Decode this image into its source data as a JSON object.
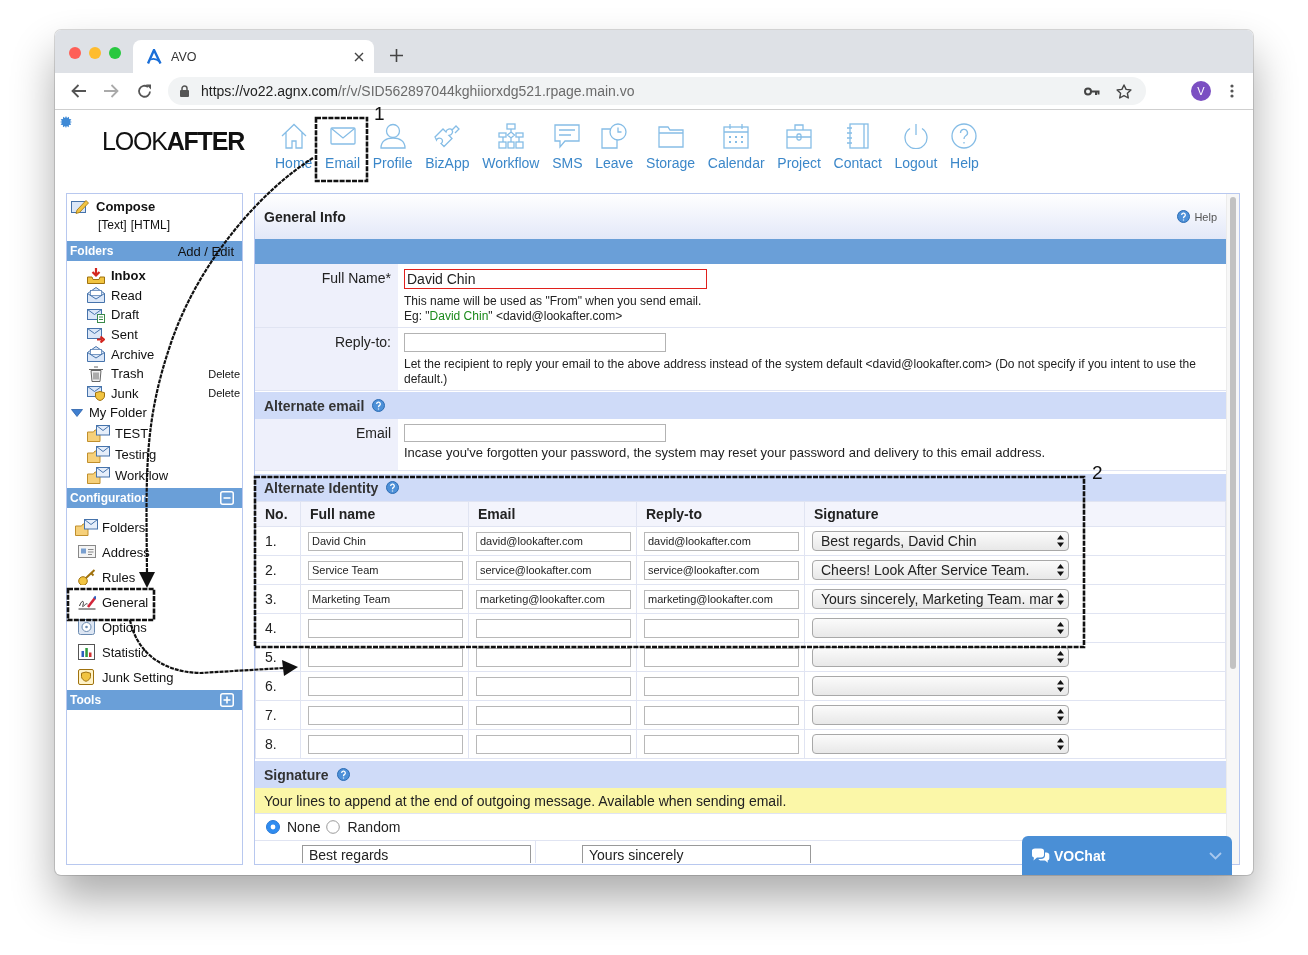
{
  "browser": {
    "tab_title": "AVO",
    "url": {
      "host": "https://vo22.agnx.com",
      "path": "/r/v/SID562897044kghiiorxdg521.rpage.main.vo"
    },
    "profile_initial": "V"
  },
  "logo": "LOOK**AFTER**",
  "nav": [
    {
      "label": "Home",
      "kind": "home"
    },
    {
      "label": "Email",
      "kind": "mail"
    },
    {
      "label": "Profile",
      "kind": "person"
    },
    {
      "label": "BizApp",
      "kind": "puzzle"
    },
    {
      "label": "Workflow",
      "kind": "flow"
    },
    {
      "label": "SMS",
      "kind": "chat"
    },
    {
      "label": "Leave",
      "kind": "clock"
    },
    {
      "label": "Storage",
      "kind": "folder"
    },
    {
      "label": "Calendar",
      "kind": "calendar"
    },
    {
      "label": "Project",
      "kind": "briefcase"
    },
    {
      "label": "Contact",
      "kind": "notebook"
    },
    {
      "label": "Logout",
      "kind": "power"
    },
    {
      "label": "Help",
      "kind": "help"
    }
  ],
  "sidebar": {
    "compose": {
      "label": "Compose",
      "formats": [
        "[Text]",
        "[HTML]"
      ]
    },
    "folders": {
      "title": "Folders",
      "action": "Add / Edit",
      "items": [
        {
          "label": "Inbox",
          "kind": "inbox",
          "unread": true
        },
        {
          "label": "Read",
          "kind": "read",
          "unread": false
        },
        {
          "label": "Draft",
          "kind": "draft",
          "unread": false
        },
        {
          "label": "Sent",
          "kind": "sent",
          "unread": false
        },
        {
          "label": "Archive",
          "kind": "archive",
          "unread": false
        },
        {
          "label": "Trash",
          "kind": "trash",
          "unread": false,
          "action": "Delete"
        },
        {
          "label": "Junk",
          "kind": "junk",
          "unread": false,
          "action": "Delete"
        },
        {
          "label": "My Folder",
          "kind": "group",
          "unread": false,
          "expanded": true,
          "children": [
            {
              "label": "TEST",
              "kind": "folder",
              "unread": false
            },
            {
              "label": "Testing",
              "kind": "folder",
              "unread": false
            },
            {
              "label": "Workflow",
              "kind": "folder",
              "unread": false
            }
          ]
        }
      ]
    },
    "configuration": {
      "title": "Configuration",
      "expanded": true,
      "items": [
        {
          "label": "Folders",
          "kind": "folders"
        },
        {
          "label": "Address",
          "kind": "address"
        },
        {
          "label": "Rules",
          "kind": "rules"
        },
        {
          "label": "General",
          "kind": "general"
        },
        {
          "label": "Options",
          "kind": "options"
        },
        {
          "label": "Statistic",
          "kind": "statistic"
        },
        {
          "label": "Junk Setting",
          "kind": "junk_setting"
        }
      ]
    },
    "tools": {
      "title": "Tools",
      "expanded": false
    }
  },
  "main": {
    "title": "General Info",
    "help": "Help",
    "identity_fields": [
      {
        "label": "Full Name*",
        "value": "David Chin",
        "required": true,
        "hint": "This name will be used as \"From\" when you send email.",
        "example": {
          "before": "Eg: \"",
          "name": "David Chin",
          "after": "\" <david@lookafter.com>"
        }
      },
      {
        "label": "Reply-to:",
        "required": false,
        "hint": "Let the recipient to reply your email to the above address instead of the system default <david@lookafter.com> (Do not specify if you intent to use the default.)"
      }
    ],
    "alternate_email": {
      "title": "Alternate email",
      "fields": [
        {
          "label": "Email",
          "required": false,
          "hint": "Incase you've forgotten your password, the system may reset your password and delivery to this email address."
        }
      ]
    },
    "alternate_identity": {
      "title": "Alternate Identity",
      "columns": [
        "No.",
        "Full name",
        "Email",
        "Reply-to",
        "Signature"
      ],
      "rows": [
        {
          "no": "1.",
          "full_name": "David Chin",
          "email": "david@lookafter.com",
          "reply_to": "david@lookafter.com",
          "signature": "Best regards, David Chin"
        },
        {
          "no": "2.",
          "full_name": "Service Team",
          "email": "service@lookafter.com",
          "reply_to": "service@lookafter.com",
          "signature": "Cheers! Look After Service Team."
        },
        {
          "no": "3.",
          "full_name": "Marketing Team",
          "email": "marketing@lookafter.com",
          "reply_to": "marketing@lookafter.com",
          "signature": "Yours sincerely, Marketing Team. mar"
        },
        {
          "no": "4."
        },
        {
          "no": "5."
        },
        {
          "no": "6."
        },
        {
          "no": "7."
        },
        {
          "no": "8."
        }
      ]
    },
    "signature": {
      "title": "Signature",
      "notice": "Your lines to append at the end of outgoing message. Available when sending email.",
      "options": [
        {
          "label": "None",
          "selected": true
        },
        {
          "label": "Random",
          "selected": false
        }
      ],
      "entries": [
        "Best regards",
        "Yours sincerely"
      ]
    }
  },
  "chat_widget": {
    "label": "VOChat"
  },
  "annotations": {
    "numbers": [
      "1",
      "2"
    ]
  }
}
